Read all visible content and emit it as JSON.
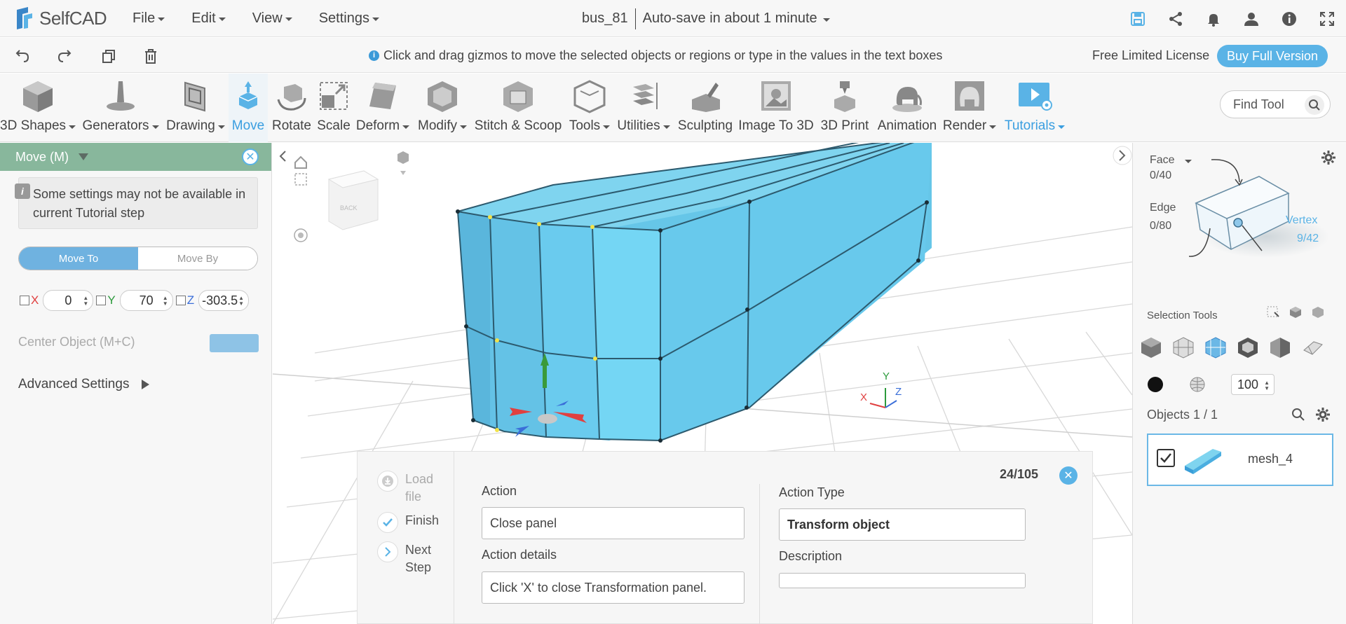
{
  "app": {
    "logo_text": "SelfCAD"
  },
  "menu": [
    {
      "label": "File"
    },
    {
      "label": "Edit"
    },
    {
      "label": "View"
    },
    {
      "label": "Settings"
    }
  ],
  "document": {
    "name": "bus_81",
    "autosave": "Auto-save in about 1 minute"
  },
  "hint": "Click and drag gizmos to move the selected objects or regions or type in the values in the text boxes",
  "license": {
    "text": "Free Limited License",
    "buy_label": "Buy Full Version"
  },
  "toolbar": {
    "tools": [
      {
        "label": "3D Shapes",
        "dropdown": true
      },
      {
        "label": "Generators",
        "dropdown": true
      },
      {
        "label": "Drawing",
        "dropdown": true
      },
      {
        "label": "Move",
        "active": true
      },
      {
        "label": "Rotate"
      },
      {
        "label": "Scale"
      },
      {
        "label": "Deform",
        "dropdown": true
      },
      {
        "label": "Modify",
        "dropdown": true
      },
      {
        "label": "Stitch & Scoop"
      },
      {
        "label": "Tools",
        "dropdown": true
      },
      {
        "label": "Utilities",
        "dropdown": true
      },
      {
        "label": "Sculpting"
      },
      {
        "label": "Image To 3D"
      },
      {
        "label": "3D Print"
      },
      {
        "label": "Animation"
      },
      {
        "label": "Render",
        "dropdown": true
      },
      {
        "label": "Tutorials",
        "dropdown": true
      }
    ],
    "find_placeholder": "Find Tool"
  },
  "move_panel": {
    "title": "Move (M)",
    "notice": "Some settings may not be available in current Tutorial step",
    "segment": {
      "move_to": "Move To",
      "move_by": "Move By",
      "selected": "Move To"
    },
    "coords": {
      "x_label": "X",
      "x_value": "0",
      "y_label": "Y",
      "y_value": "70",
      "z_label": "Z",
      "z_value": "-303.5"
    },
    "center_object": "Center Object (M+C)",
    "advanced": "Advanced Settings"
  },
  "tutorial": {
    "steps": [
      {
        "label": "Load file",
        "state": "disabled"
      },
      {
        "label": "Finish",
        "state": "done"
      },
      {
        "label": "Next Step",
        "state": "next"
      }
    ],
    "action_label": "Action",
    "action_value": "Close panel",
    "details_label": "Action details",
    "details_value": "Click 'X' to close Transformation panel.",
    "type_label": "Action Type",
    "type_value": "Transform object",
    "description_label": "Description",
    "description_value": "",
    "counter": "24/105"
  },
  "selection": {
    "face_label": "Face",
    "face_count": "0/40",
    "edge_label": "Edge",
    "edge_count": "0/80",
    "vertex_label": "Vertex",
    "vertex_count": "9/42",
    "tools_label": "Selection Tools",
    "brush_value": "100"
  },
  "objects": {
    "header": "Objects 1 / 1",
    "items": [
      {
        "name": "mesh_4",
        "checked": true
      }
    ]
  },
  "colors": {
    "accent": "#5ab3e6",
    "mesh": "#6ccfee",
    "panel_head": "#88b79c"
  }
}
